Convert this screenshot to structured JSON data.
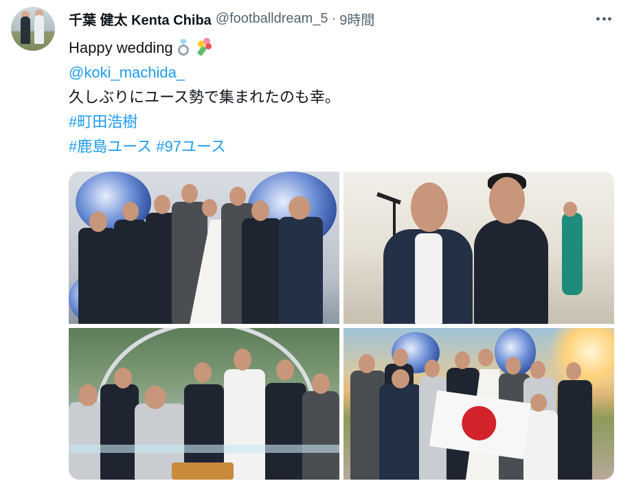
{
  "user": {
    "display_name": "千葉 健太 Kenta Chiba",
    "handle": "@footballdream_5",
    "separator": "·",
    "time": "9時間"
  },
  "tweet": {
    "line1": "Happy wedding",
    "mention": "@koki_machida_",
    "line3": "久しぶりにユース勢で集まれたのも幸。",
    "hashtag1": "#町田浩樹",
    "hashtag2": "#鹿島ユース",
    "hashtag3": "#97ユース"
  },
  "icons": {
    "more": "more-icon",
    "ring": "ring-emoji",
    "bouquet": "bouquet-emoji"
  },
  "colors": {
    "link": "#1d9bf0",
    "secondary_text": "#536471",
    "primary_text": "#0f1419"
  }
}
